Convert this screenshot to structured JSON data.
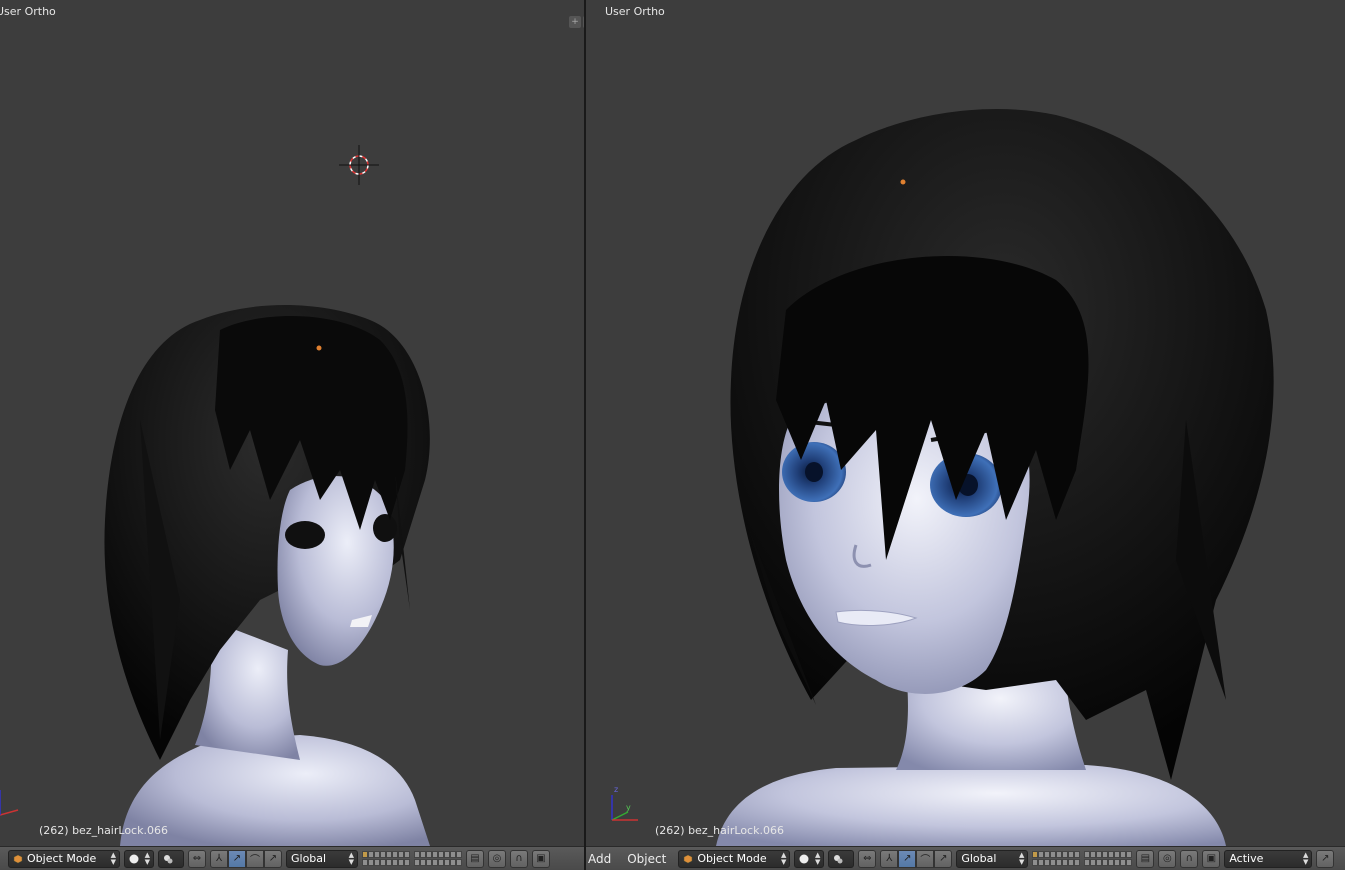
{
  "left_view": {
    "label": "User Ortho",
    "object_info": "(262) bez_hairLock.066"
  },
  "right_view": {
    "label": "User Ortho",
    "object_info": "(262) bez_hairLock.066"
  },
  "left_header": {
    "mode": "Object Mode",
    "orientation": "Global"
  },
  "right_header": {
    "menu_add": "Add",
    "menu_object": "Object",
    "mode": "Object Mode",
    "orientation": "Global",
    "pivot": "Active"
  },
  "colors": {
    "viewport_bg": "#3d3d3d",
    "header_bg": "#4a4a4a",
    "accent_active": "#5478a6",
    "skin": "#c8cbe0",
    "hair": "#0b0b0b",
    "eye": "#3563a8"
  }
}
